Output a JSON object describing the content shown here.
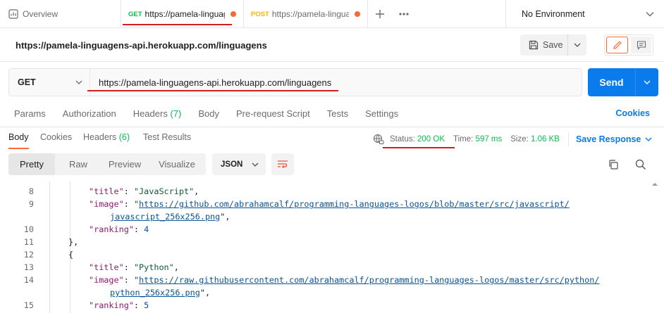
{
  "tabs": {
    "overview": "Overview",
    "get_tab": {
      "method": "GET",
      "url": "https://pamela-linguag"
    },
    "post_tab": {
      "method": "POST",
      "url": "https://pamela-lingua"
    },
    "add_icon": "plus-icon",
    "more_icon": "more-icon"
  },
  "environment": {
    "selected": "No Environment"
  },
  "request": {
    "title": "https://pamela-linguagens-api.herokuapp.com/linguagens",
    "save_label": "Save",
    "method": "GET",
    "url": "https://pamela-linguagens-api.herokuapp.com/linguagens",
    "send_label": "Send"
  },
  "request_tabs": {
    "params": "Params",
    "authorization": "Authorization",
    "headers": "Headers",
    "headers_count": "(7)",
    "body": "Body",
    "prerequest": "Pre-request Script",
    "tests": "Tests",
    "settings": "Settings",
    "cookies": "Cookies"
  },
  "response_tabs": {
    "body": "Body",
    "cookies": "Cookies",
    "headers": "Headers",
    "headers_count": "(6)",
    "test_results": "Test Results"
  },
  "response_meta": {
    "status_label": "Status:",
    "status_value": "200 OK",
    "time_label": "Time:",
    "time_value": "597 ms",
    "size_label": "Size:",
    "size_value": "1.06 KB",
    "save_response": "Save Response"
  },
  "view": {
    "tabs": [
      "Pretty",
      "Raw",
      "Preview",
      "Visualize"
    ],
    "active": "Pretty",
    "format": "JSON"
  },
  "code": [
    {
      "n": "8",
      "key": "\"title\"",
      "sep": ": ",
      "val": "\"JavaScript\"",
      "end": ","
    },
    {
      "n": "9",
      "key": "\"image\"",
      "sep": ": ",
      "q": "\"",
      "url": "https://github.com/abrahamcalf/programming-languages-logos/blob/master/src/javascript/"
    },
    {
      "n": "",
      "url": "javascript_256x256.png",
      "end": "\","
    },
    {
      "n": "10",
      "key": "\"ranking\"",
      "sep": ": ",
      "num": "4"
    },
    {
      "n": "11",
      "punct": "},"
    },
    {
      "n": "12",
      "punct": "{"
    },
    {
      "n": "13",
      "key": "\"title\"",
      "sep": ": ",
      "val": "\"Python\"",
      "end": ","
    },
    {
      "n": "14",
      "key": "\"image\"",
      "sep": ": ",
      "q": "\"",
      "url": "https://raw.githubusercontent.com/abrahamcalf/programming-languages-logos/master/src/python/"
    },
    {
      "n": "",
      "url": "python_256x256.png",
      "end": "\","
    },
    {
      "n": "15",
      "key": "\"ranking\"",
      "sep": ": ",
      "num": "5"
    }
  ]
}
